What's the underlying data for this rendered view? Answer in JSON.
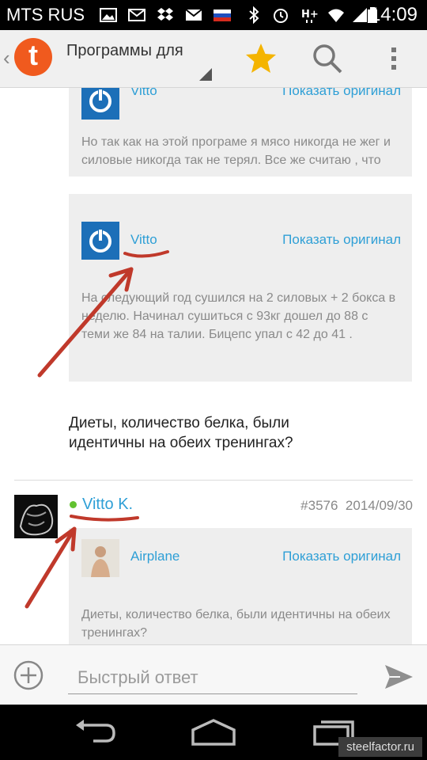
{
  "status_bar": {
    "carrier": "MTS RUS",
    "time": "14:09",
    "icons": [
      "image-icon",
      "gmail-icon",
      "dropbox-icon",
      "email-icon",
      "russian-flag-icon",
      "bluetooth-icon",
      "alarm-icon",
      "hplus-signal-icon",
      "wifi-icon",
      "signal-icon",
      "battery-icon"
    ]
  },
  "action_bar": {
    "app_icon": "tapatalk-icon",
    "title": "Программы для",
    "actions": [
      "star-icon",
      "search-icon",
      "overflow-icon"
    ],
    "accent_color": "#f05a1e",
    "star_color": "#f4b400"
  },
  "thread": {
    "quote_top": {
      "author": "Vitto",
      "show_original": "Показать оригинал",
      "text": "Но так как на этой програме я мясо никогда не жег и силовые никогда так не терял. Все же считаю , что"
    },
    "quote_mid": {
      "author": "Vitto",
      "show_original": "Показать оригинал",
      "text": "На следующий год сушился на 2 силовых + 2 бокса в неделю. Начинал сушиться с 93кг дошел до 88 с теми же 84 на талии. Бицепс упал с 42 до 41 ."
    },
    "reply_text": "Диеты, количество белка, были идентичны на обеих тренингах?",
    "post": {
      "username": "Vitto K.",
      "post_number": "#3576",
      "date": "2014/09/30",
      "quote": {
        "author": "Airplane",
        "show_original": "Показать оригинал",
        "text": "Диеты, количество белка, были идентичны на обеих тренингах?"
      }
    }
  },
  "quick_reply": {
    "placeholder": "Быстрый ответ"
  },
  "nav_bar": {
    "icons": [
      "back-icon",
      "home-icon",
      "recent-apps-icon"
    ]
  },
  "watermark": "steelfactor.ru",
  "link_color": "#2e9fd6",
  "annotation_color": "#c0392b"
}
